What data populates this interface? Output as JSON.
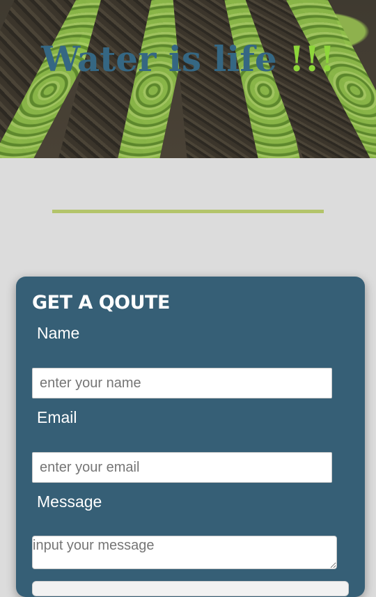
{
  "hero": {
    "title_main": "Water is life ",
    "title_accent": "!!!"
  },
  "form": {
    "title": "GET A QOUTE",
    "name_label": "Name",
    "name_placeholder": "enter your name",
    "email_label": "Email",
    "email_placeholder": "enter your email",
    "message_label": "Message",
    "message_placeholder": "input your message"
  },
  "colors": {
    "hero_title": "#356783",
    "accent": "#8ed63b",
    "divider": "#b3c46a",
    "card_bg": "#365f76",
    "page_bg": "#dcdcdc"
  }
}
